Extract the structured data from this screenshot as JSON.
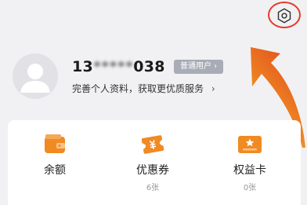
{
  "header": {
    "settings_icon": "gear-icon"
  },
  "profile": {
    "phone_prefix": "13",
    "phone_masked": "*****",
    "phone_suffix": "038",
    "member_badge": "普通用户 ›",
    "complete_profile_link": "完善个人资料，获取更优质服务",
    "complete_profile_chevron": "›"
  },
  "assets": [
    {
      "label": "余额",
      "count": ""
    },
    {
      "label": "优惠券",
      "count": "6张"
    },
    {
      "label": "权益卡",
      "count": "0张"
    }
  ],
  "colors": {
    "accent_orange": "#f08a22",
    "highlight_red": "#e53a2a",
    "badge_gray": "#a9acb6"
  }
}
